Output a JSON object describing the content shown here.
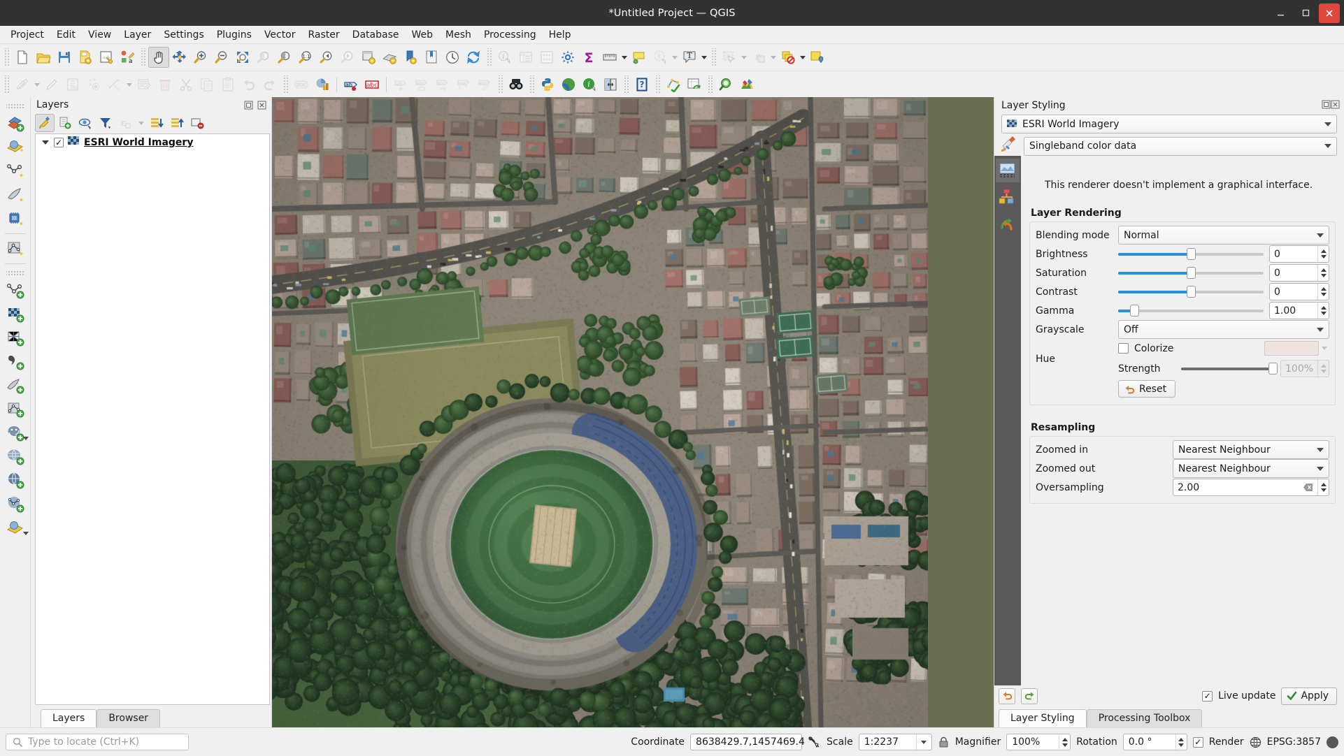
{
  "window": {
    "title": "*Untitled Project — QGIS",
    "minimize_label": "Minimize",
    "maximize_label": "Maximize",
    "close_label": "Close"
  },
  "menubar": {
    "items": [
      "Project",
      "Edit",
      "View",
      "Layer",
      "Settings",
      "Plugins",
      "Vector",
      "Raster",
      "Database",
      "Web",
      "Mesh",
      "Processing",
      "Help"
    ]
  },
  "toolbar_row1": {
    "icons": [
      "new-project-icon",
      "open-project-icon",
      "save-project-icon",
      "save-project-as-icon",
      "new-print-layout-icon",
      "style-manager-icon",
      "pan-map-icon",
      "pan-to-selection-icon",
      "zoom-in-icon",
      "zoom-out-icon",
      "zoom-full-icon",
      "zoom-to-selection-icon",
      "zoom-to-layer-icon",
      "zoom-native-icon",
      "zoom-last-icon",
      "zoom-next-icon",
      "new-map-view-icon",
      "new-3d-map-view-icon",
      "show-bookmarks-icon",
      "new-bookmark-icon",
      "temporal-controller-icon",
      "refresh-icon",
      "identify-features-icon",
      "open-attribute-table-icon",
      "field-calculator-icon",
      "options-icon",
      "statistical-summary-icon",
      "measure-line-icon",
      "map-tips-icon",
      "show-statistics-icon",
      "text-annotation-icon",
      "select-features-icon",
      "select-by-expression-icon",
      "deselect-features-icon",
      "new-annotation-layer-icon"
    ]
  },
  "toolbar_row2": {
    "icons": [
      "current-edits-icon",
      "toggle-editing-icon",
      "save-layer-edits-icon",
      "add-feature-icon",
      "vertex-tool-icon",
      "modify-attributes-icon",
      "delete-selected-icon",
      "cut-features-icon",
      "copy-features-icon",
      "paste-features-icon",
      "undo-icon",
      "redo-icon",
      "label-toolbar-icon",
      "layer-diagram-icon",
      "pin-labels-icon",
      "show-hide-labels-icon",
      "move-label-icon",
      "rotate-label-icon",
      "change-label-icon",
      "highlight-pinned-labels-icon",
      "metasearch-icon",
      "python-console-icon",
      "openlayers-icon",
      "quickmapservices-icon",
      "georeferencer-icon",
      "help-icon",
      "topology-checker-icon",
      "refresh-attribute-table-icon",
      "search-layers-icon",
      "processing-icon"
    ]
  },
  "vertical_toolbar": {
    "icons": [
      "new-shapefile-layer-icon",
      "new-geopackage-layer-icon",
      "new-spatialite-layer-icon",
      "new-virtual-layer-icon",
      "new-memory-layer-icon",
      "new-mesh-layer-icon",
      "add-vector-layer-icon",
      "add-raster-layer-icon",
      "add-mesh-layer-icon",
      "add-delimited-text-layer-icon",
      "add-spatialite-layer-icon",
      "add-virtual-layer-icon",
      "add-postgis-layer-icon",
      "add-wms-layer-icon",
      "add-wfs-layer-icon",
      "add-wcs-layer-icon",
      "add-xyz-layer-icon"
    ]
  },
  "layers_panel": {
    "title": "Layers",
    "float_label": "Float panel",
    "close_label": "Close panel",
    "toolbar_icons": [
      "open-layer-styling-panel-icon",
      "add-group-icon",
      "manage-map-themes-icon",
      "filter-legend-icon",
      "filter-legend-by-expression-icon",
      "expand-all-icon",
      "collapse-all-icon",
      "remove-layer-icon"
    ],
    "layers": [
      {
        "name": "ESRI World Imagery",
        "checked": true,
        "icon": "raster-layer-icon"
      }
    ],
    "tabs": [
      {
        "label": "Layers",
        "active": true
      },
      {
        "label": "Browser",
        "active": false
      }
    ]
  },
  "layer_styling": {
    "title": "Layer Styling",
    "float_label": "Float panel",
    "close_label": "Close panel",
    "layer_selector": {
      "value": "ESRI World Imagery",
      "icon": "raster-layer-icon"
    },
    "renderer": {
      "icon": "symbology-brush-icon",
      "value": "Singleband color data"
    },
    "strip_icons": [
      "symbology-icon",
      "transparency-icon",
      "histogram-icon"
    ],
    "renderer_message": "This renderer doesn't implement a graphical interface.",
    "layer_rendering": {
      "title": "Layer Rendering",
      "blending_mode": {
        "label": "Blending mode",
        "value": "Normal"
      },
      "brightness": {
        "label": "Brightness",
        "value": "0",
        "slider_pct": 50
      },
      "saturation": {
        "label": "Saturation",
        "value": "0",
        "slider_pct": 50
      },
      "contrast": {
        "label": "Contrast",
        "value": "0",
        "slider_pct": 50
      },
      "gamma": {
        "label": "Gamma",
        "value": "1.00",
        "slider_pct": 11
      },
      "grayscale": {
        "label": "Grayscale",
        "value": "Off"
      },
      "hue": {
        "label": "Hue"
      },
      "colorize": {
        "label": "Colorize",
        "checked": false,
        "color": "#efe3e0"
      },
      "strength": {
        "label": "Strength",
        "value": "100%",
        "slider_pct": 100
      },
      "reset": {
        "label": "Reset",
        "icon": "reset-arrow-icon"
      }
    },
    "resampling": {
      "title": "Resampling",
      "zoomed_in": {
        "label": "Zoomed in",
        "value": "Nearest Neighbour"
      },
      "zoomed_out": {
        "label": "Zoomed out",
        "value": "Nearest Neighbour"
      },
      "oversampling": {
        "label": "Oversampling",
        "value": "2.00"
      }
    },
    "footer": {
      "undo_icon": "undo-icon",
      "redo_icon": "redo-icon",
      "live_update": {
        "label": "Live update",
        "checked": true
      },
      "apply": {
        "label": "Apply",
        "icon": "check-icon"
      }
    },
    "tabs": [
      {
        "label": "Layer Styling",
        "active": true
      },
      {
        "label": "Processing Toolbox",
        "active": false
      }
    ]
  },
  "statusbar": {
    "locator_placeholder": "Type to locate (Ctrl+K)",
    "coordinate": {
      "label": "Coordinate",
      "value": "8638429.7,1457469.4"
    },
    "toggle_extents_icon": "toggle-extents-icon",
    "scale": {
      "label": "Scale",
      "value": "1:2237"
    },
    "lock_icon": "lock-scale-icon",
    "magnifier": {
      "label": "Magnifier",
      "value": "100%"
    },
    "rotation": {
      "label": "Rotation",
      "value": "0.0 °"
    },
    "render": {
      "label": "Render",
      "checked": true
    },
    "crs": {
      "label": "EPSG:3857",
      "icon": "crs-globe-icon"
    },
    "messages_icon": "messages-icon"
  },
  "map": {
    "description": "Satellite imagery of a dense urban area with a large circular cricket stadium"
  },
  "colors": {
    "accent_blue": "#2d8fd5",
    "titlebar": "#323232",
    "panel_bg": "#f0f0f0",
    "strip_bg": "#5a5a5a"
  }
}
